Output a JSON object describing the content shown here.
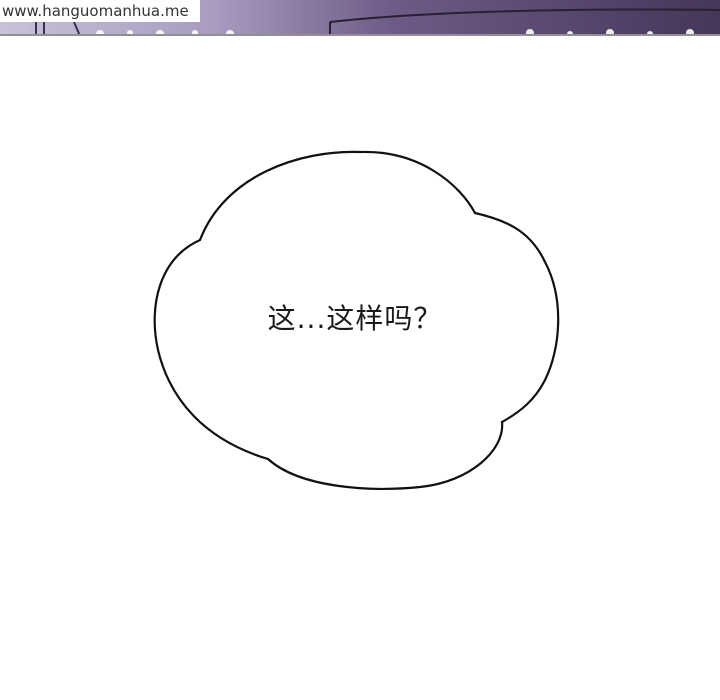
{
  "watermark": {
    "text": "www.hanguomanhua.me"
  },
  "speech_bubble": {
    "text": "这...这样吗？"
  },
  "colors": {
    "top_strip_dark": "#4a3a5e",
    "top_strip_light": "#b9b0cc",
    "bubble_outline": "#111111",
    "background": "#ffffff"
  }
}
